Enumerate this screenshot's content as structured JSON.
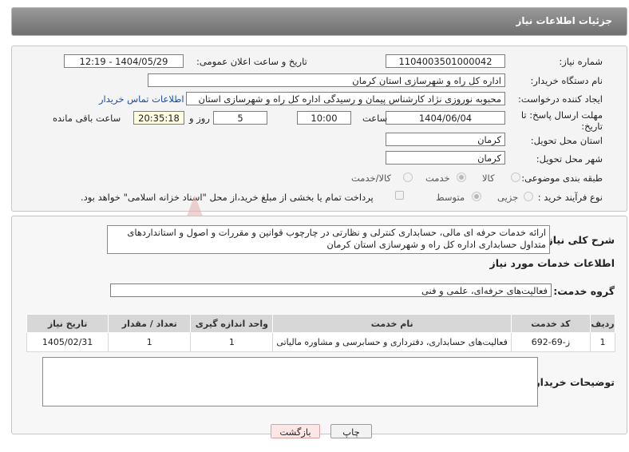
{
  "header": {
    "title": "جزئیات اطلاعات نیاز"
  },
  "fields": {
    "need_number_label": "شماره نیاز:",
    "need_number": "1104003501000042",
    "announce_label": "تاریخ و ساعت اعلان عمومی:",
    "announce_value": "1404/05/29 - 12:19",
    "buyer_org_label": "نام دستگاه خریدار:",
    "buyer_org": "اداره کل راه و شهرسازی استان کرمان",
    "creator_label": "ایجاد کننده درخواست:",
    "creator": "محبوبه نوروزی نژاد کارشناس پیمان و رسیدگی اداره کل راه و شهرسازی استان",
    "contact_link": "اطلاعات تماس خریدار",
    "deadline_label_1": "مهلت ارسال پاسخ: تا",
    "deadline_label_2": "تاریخ:",
    "deadline_date": "1404/06/04",
    "time_label": "ساعت",
    "deadline_time": "10:00",
    "days": "5",
    "days_label": "روز و",
    "remaining": "20:35:18",
    "remaining_label": "ساعت باقی مانده",
    "province_label": "استان محل تحویل:",
    "province": "کرمان",
    "city_label": "شهر محل تحویل:",
    "city": "کرمان",
    "category_label": "طبقه بندی موضوعی:",
    "category_options": [
      "کالا",
      "خدمت",
      "کالا/خدمت"
    ],
    "process_label": "نوع فرآیند خرید :",
    "process_options": [
      "جزیی",
      "متوسط"
    ],
    "payment_note": "پرداخت تمام یا بخشی از مبلغ خرید،از محل \"اسناد خزانه اسلامی\" خواهد بود."
  },
  "summary": {
    "label": "شرح کلی نیاز:",
    "text": "ارائه خدمات حرفه ای مالی، حسابداری کنترلی و نظارتی در چارچوب قوانین و مقررات و اصول و استانداردهای متداول حسابداری اداره کل راه و شهرسازی استان کرمان"
  },
  "services": {
    "section_title": "اطلاعات خدمات مورد نیاز",
    "group_label": "گروه خدمت:",
    "group_value": "فعالیت‌های حرفه‌ای، علمی و فنی",
    "columns": [
      "ردیف",
      "کد خدمت",
      "نام خدمت",
      "واحد اندازه گیری",
      "تعداد / مقدار",
      "تاریخ نیاز"
    ],
    "rows": [
      [
        "1",
        "ز-69-692",
        "فعالیت‌های حسابداری، دفترداری و حسابرسی و مشاوره مالیاتی",
        "1",
        "1",
        "1405/02/31"
      ]
    ]
  },
  "buyer_notes": {
    "label": "توضیحات خریدار:",
    "value": ""
  },
  "buttons": {
    "print": "چاپ",
    "back": "بازگشت"
  },
  "watermark": {
    "text": "AriaTender.neT"
  },
  "colors": {
    "header": "#7d7d7d",
    "link": "#1a4fa0",
    "back_button": "#fde6e6",
    "print_button": "#f2f2f2",
    "watermark": "#e8b4b4"
  }
}
